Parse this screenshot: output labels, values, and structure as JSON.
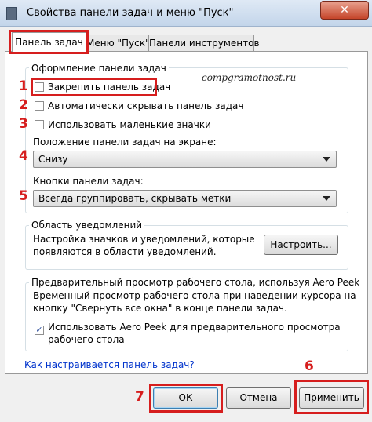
{
  "window": {
    "title": "Свойства панели задач и меню \"Пуск\"",
    "close_label": "✕"
  },
  "tabs": [
    {
      "label": "Панель задач",
      "active": true
    },
    {
      "label": "Меню \"Пуск\"",
      "active": false
    },
    {
      "label": "Панели инструментов",
      "active": false
    }
  ],
  "watermark": "compgramotnost.ru",
  "taskbar_group": {
    "title": "Оформление панели задач",
    "options": [
      {
        "marker": "1",
        "label": "Закрепить панель задач",
        "checked": false
      },
      {
        "marker": "2",
        "label": "Автоматически скрывать панель задач",
        "checked": false
      },
      {
        "marker": "3",
        "label": "Использовать маленькие значки",
        "checked": false
      }
    ],
    "position_marker": "4",
    "position_label": "Положение панели задач на экране:",
    "position_value": "Снизу",
    "buttons_marker": "5",
    "buttons_label": "Кнопки панели задач:",
    "buttons_value": "Всегда группировать, скрывать метки"
  },
  "notification_group": {
    "title": "Область уведомлений",
    "text_line1": "Настройка значков и уведомлений, которые",
    "text_line2": "появляются в области уведомлений.",
    "button_label": "Настроить..."
  },
  "peek_group": {
    "title": "Предварительный просмотр рабочего стола, используя Aero Peek",
    "text_line1": "Временный просмотр рабочего стола при наведении курсора на",
    "text_line2": "кнопку \"Свернуть все окна\" в конце панели задач.",
    "checkbox_line1": "Использовать Aero Peek для предварительного просмотра",
    "checkbox_line2": "рабочего стола",
    "checked": true,
    "check_glyph": "✓"
  },
  "help_link": "Как настраивается панель задач?",
  "buttons": {
    "ok_marker": "7",
    "ok_label": "ОК",
    "cancel_label": "Отмена",
    "apply_marker": "6",
    "apply_label": "Применить"
  },
  "colors": {
    "highlight": "#d61e1e",
    "link": "#0033cc",
    "window_bg": "#f0f0f0"
  }
}
